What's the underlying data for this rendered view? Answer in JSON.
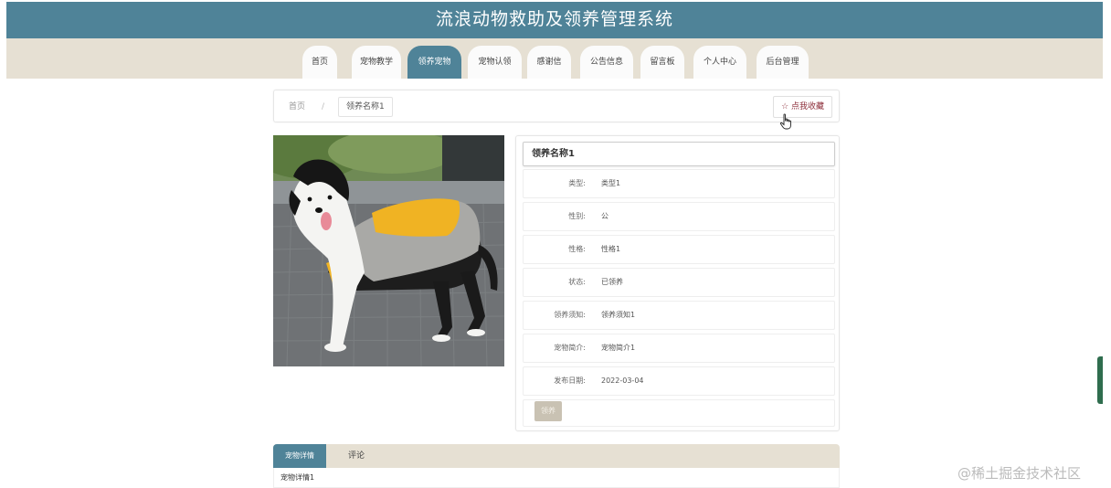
{
  "header": {
    "title": "流浪动物救助及领养管理系统"
  },
  "nav": {
    "items": [
      {
        "label": "首页"
      },
      {
        "label": "宠物教学"
      },
      {
        "label": "领养宠物"
      },
      {
        "label": "宠物认领"
      },
      {
        "label": "感谢信"
      },
      {
        "label": "公告信息"
      },
      {
        "label": "留言板"
      },
      {
        "label": "个人中心"
      },
      {
        "label": "后台管理"
      }
    ],
    "active_index": 2
  },
  "breadcrumb": {
    "home": "首页",
    "separator": "/",
    "current": "领养名称1"
  },
  "favorite": {
    "label": "☆ 点我收藏"
  },
  "detail": {
    "title": "领养名称1",
    "fields": [
      {
        "label": "类型:",
        "value": "类型1"
      },
      {
        "label": "性别:",
        "value": "公"
      },
      {
        "label": "性格:",
        "value": "性格1"
      },
      {
        "label": "状态:",
        "value": "已领养"
      },
      {
        "label": "领养须知:",
        "value": "领养须知1"
      },
      {
        "label": "宠物简介:",
        "value": "宠物简介1"
      },
      {
        "label": "发布日期:",
        "value": "2022-03-04"
      }
    ],
    "adopt_button": "领养"
  },
  "tabs": {
    "items": [
      {
        "label": "宠物详情"
      },
      {
        "label": "评论"
      }
    ],
    "content": "宠物详情1"
  },
  "watermark": "@稀土掘金技术社区",
  "colors": {
    "primary": "#4f8398",
    "nav_bg": "#e6e0d3",
    "favorite": "#8d2e3a"
  }
}
